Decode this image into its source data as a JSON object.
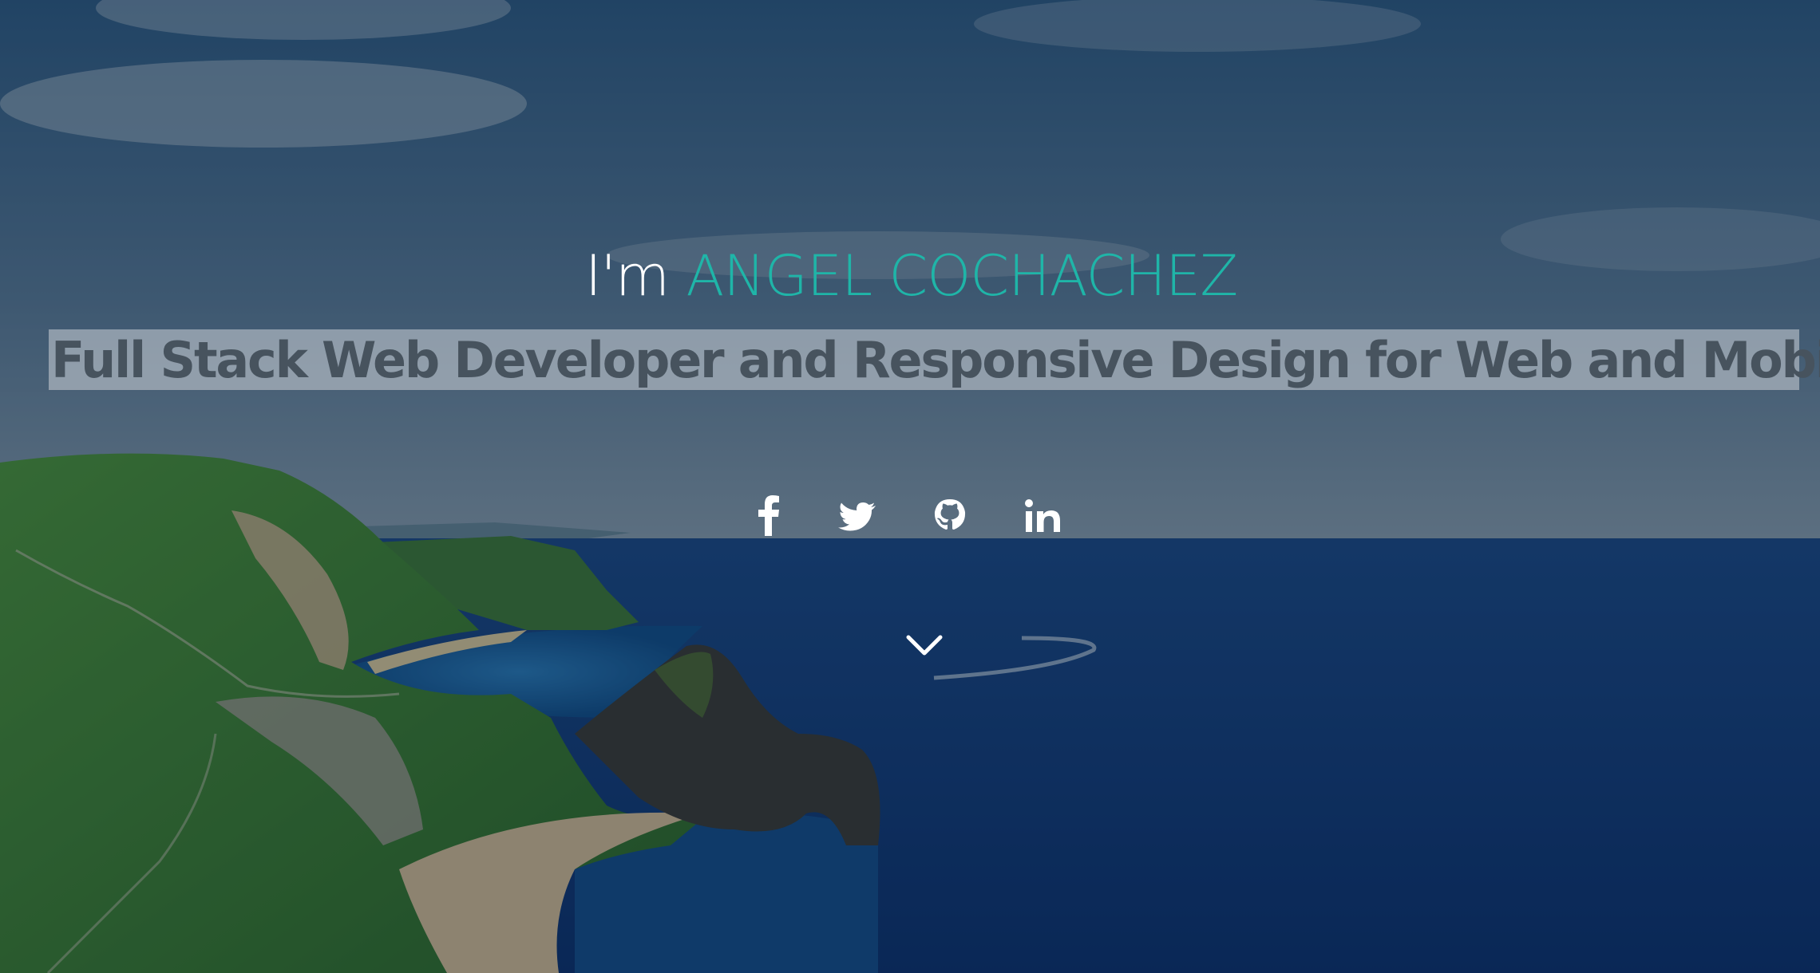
{
  "hero": {
    "greeting": "I'm",
    "name": "ANGEL COCHACHEZ",
    "tagline": "Full Stack Web Developer and Responsive Design for Web and Mobile"
  },
  "social": [
    {
      "icon": "facebook-icon"
    },
    {
      "icon": "twitter-icon"
    },
    {
      "icon": "github-icon"
    },
    {
      "icon": "linkedin-icon"
    }
  ],
  "scroll": {
    "icon": "chevron-down-icon"
  },
  "colors": {
    "accent": "#1fb5a8",
    "tagline_text": "#47535e",
    "sea": "#0f3f80",
    "grass": "#3d7a2e"
  }
}
